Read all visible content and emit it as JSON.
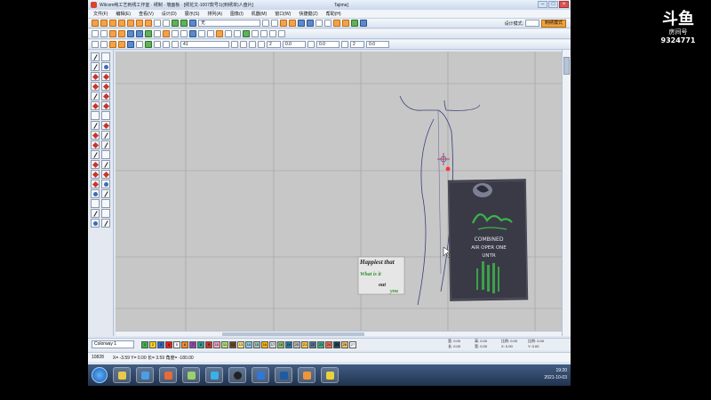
{
  "window": {
    "title": "Wilcom纯工艺刺绣工作室 · 绣制 · 墙面板 · [绣花文-1007款号1)(刺绣单)人盘片]",
    "subtitle": "Tajima]"
  },
  "menu": [
    "文件(F)",
    "编辑(E)",
    "查看(V)",
    "设计(D)",
    "展示(S)",
    "排列(A)",
    "图像(I)",
    "机器(M)",
    "窗口(W)",
    "快捷键(Z)",
    "帮助(H)"
  ],
  "toolbar1": {
    "dropdown": "无",
    "mode_label": "设计模式:",
    "mode_button": "刺绣模式"
  },
  "toolbar2": {
    "field": "41",
    "n1": "2",
    "n2": "0.0",
    "n3": "0.0",
    "n4": "2",
    "n5": "0.0"
  },
  "canvas_text": {
    "card_line1": "Happiest that",
    "card_line2": "What is it",
    "card_line3": "out",
    "card_line4": "you",
    "label_line1": "COMBINED",
    "label_line2": "AIR OPER ONE",
    "label_line3": "UNTR"
  },
  "colorbar": {
    "colorway": "Colorway 1",
    "swatches": [
      {
        "n": "1",
        "c": "#39b54a"
      },
      {
        "n": "2",
        "c": "#f7d11e"
      },
      {
        "n": "3",
        "c": "#2d66c4"
      },
      {
        "n": "4",
        "c": "#e02020"
      },
      {
        "n": "5",
        "c": "#ffffff"
      },
      {
        "n": "6",
        "c": "#f28c28"
      },
      {
        "n": "7",
        "c": "#8e44ad"
      },
      {
        "n": "8",
        "c": "#2a9d8f"
      },
      {
        "n": "9",
        "c": "#c0392b"
      },
      {
        "n": "10",
        "c": "#f5a6c6"
      },
      {
        "n": "11",
        "c": "#b7e07a"
      },
      {
        "n": "12",
        "c": "#6b4a2b"
      },
      {
        "n": "13",
        "c": "#f4e285"
      },
      {
        "n": "14",
        "c": "#8ecae6"
      },
      {
        "n": "15",
        "c": "#a3c4bc"
      },
      {
        "n": "16",
        "c": "#ffb703"
      },
      {
        "n": "17",
        "c": "#d9d9d9"
      },
      {
        "n": "18",
        "c": "#90be6d"
      },
      {
        "n": "19",
        "c": "#277da1"
      },
      {
        "n": "20",
        "c": "#bdbdbd"
      },
      {
        "n": "21",
        "c": "#f9c74f"
      },
      {
        "n": "22",
        "c": "#577590"
      },
      {
        "n": "23",
        "c": "#43aa8b"
      },
      {
        "n": "24",
        "c": "#e76f51"
      },
      {
        "n": "25",
        "c": "#264653"
      },
      {
        "n": "26",
        "c": "#e9c46a"
      },
      {
        "n": "27",
        "c": "#ffffff"
      }
    ]
  },
  "coords": {
    "l1": "宽: 0.00",
    "l2": "高: 0.00",
    "l3": "比例: 0.00",
    "l4": "比例: 0.00",
    "l5": "长: 0.00",
    "l6": "宽: 0.00",
    "l7": "X: 0.00",
    "l8": "Y: 0.00"
  },
  "status": {
    "stitches": "10828",
    "xy": "X= -3.59 Y= 0.00 长= 3.59 角度= -180.00"
  },
  "tray": {
    "time": "19:20",
    "date": "2021-10-03"
  },
  "overlay": {
    "mark": "斗鱼",
    "room_label": "房间号",
    "room_number": "9324771"
  },
  "colors": {
    "canvas": "#c7c7c7",
    "accent": "#f0a23c",
    "taskbar": "#2b4466"
  }
}
